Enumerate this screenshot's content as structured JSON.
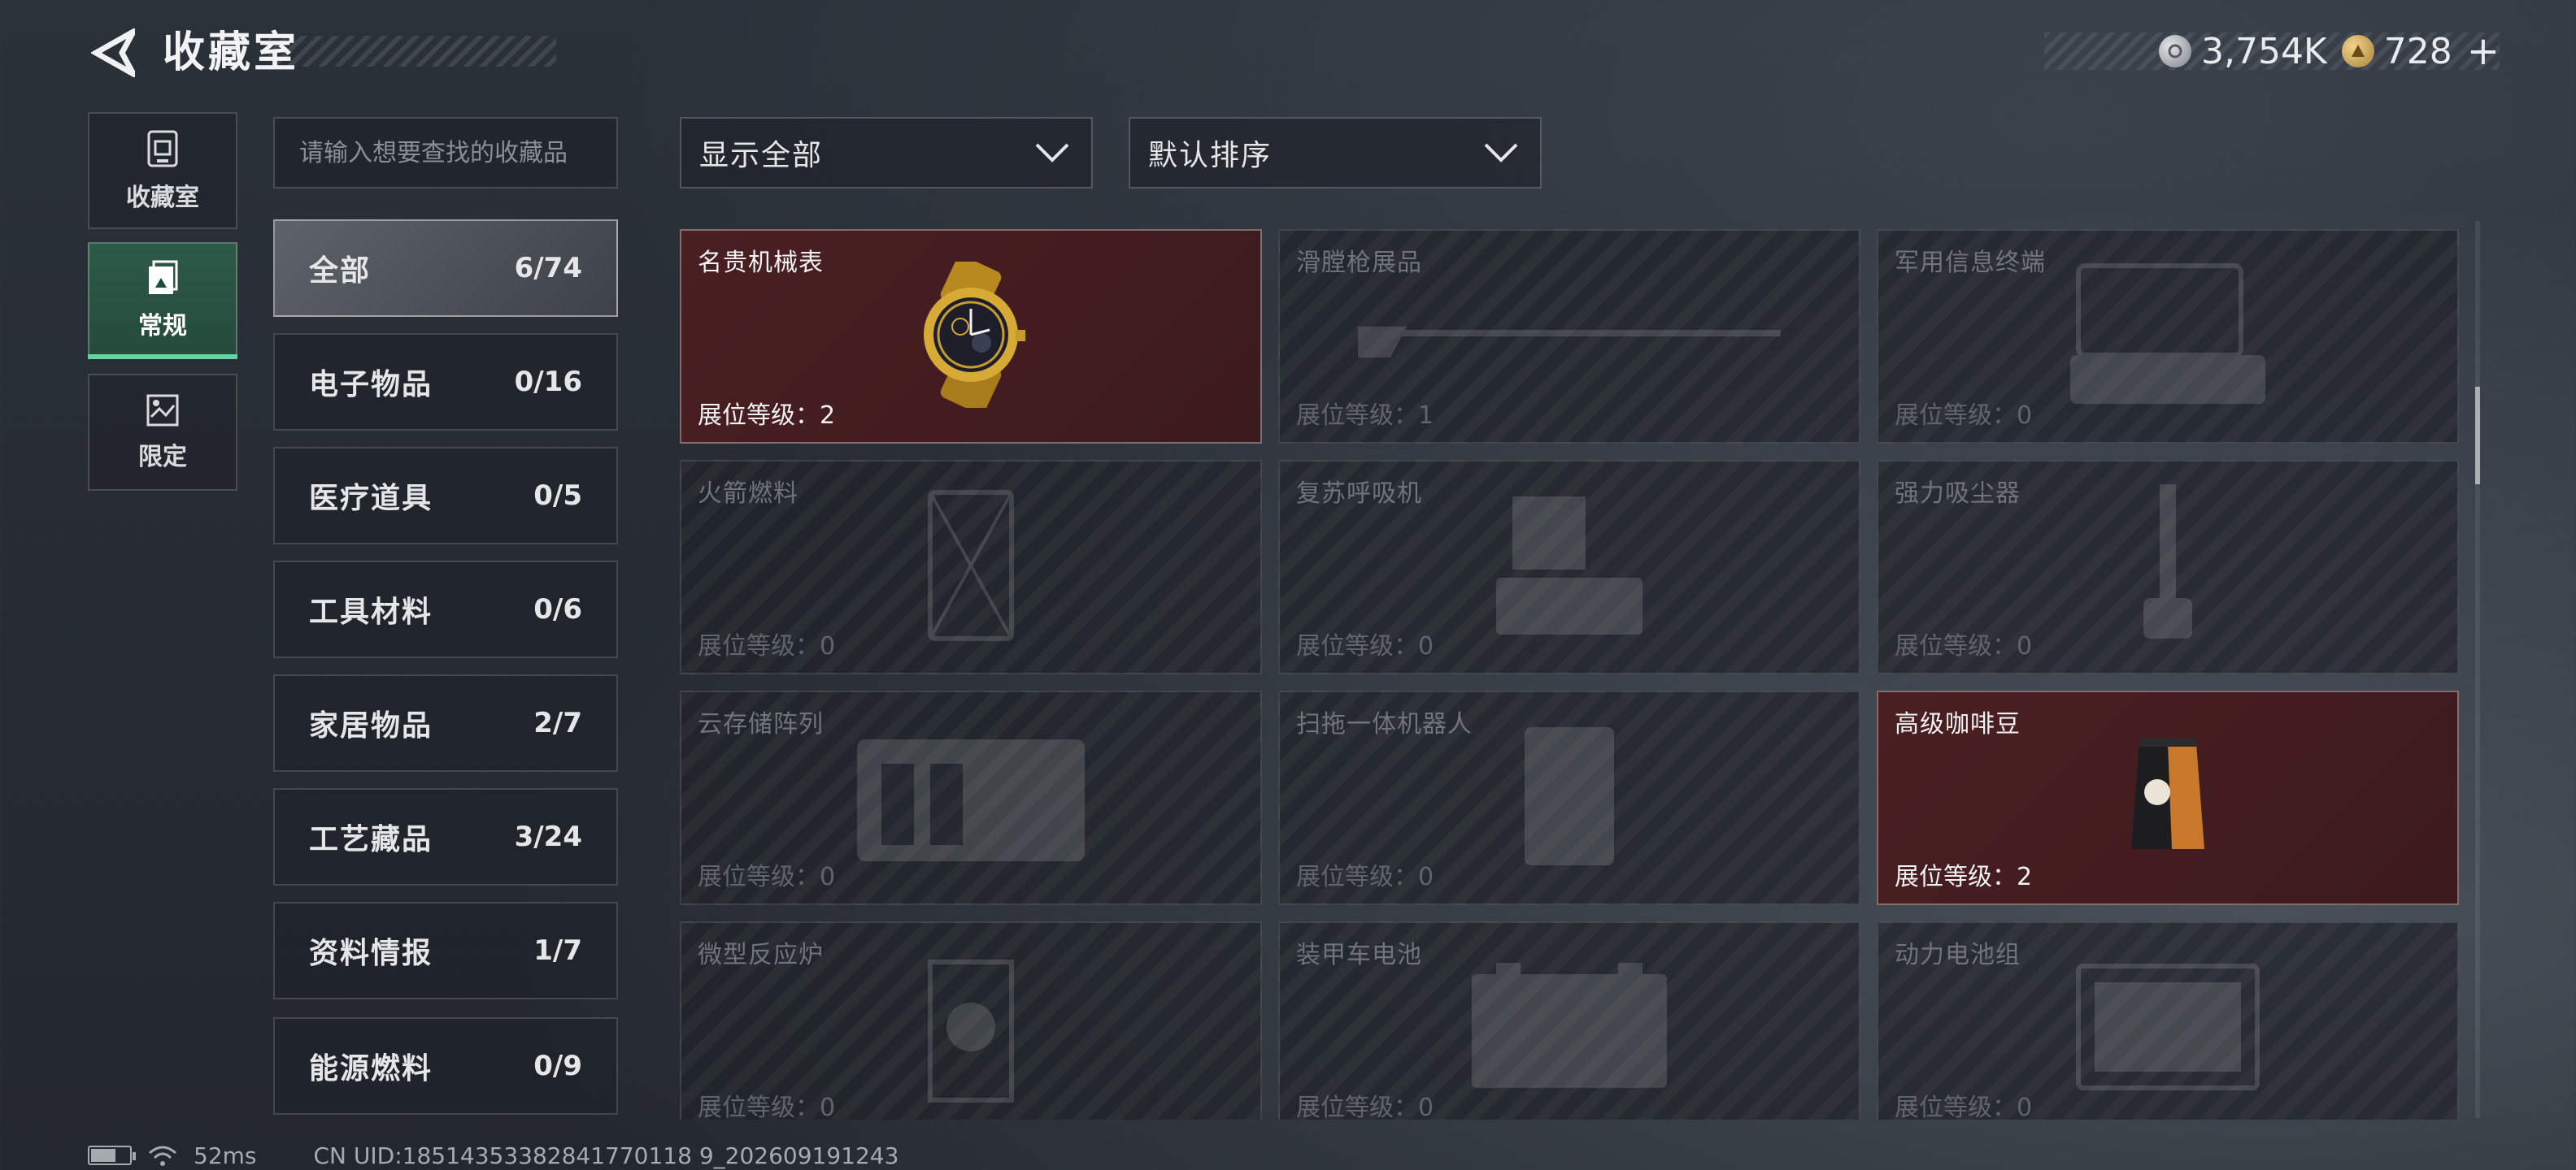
{
  "header": {
    "title": "收藏室",
    "currency": [
      {
        "icon": "silver-coin-icon",
        "value": "3,754K"
      },
      {
        "icon": "gold-coin-icon",
        "value": "728"
      }
    ],
    "add_label": "+"
  },
  "side_tabs": [
    {
      "label": "收藏室",
      "icon": "collection-room-icon",
      "active": false
    },
    {
      "label": "常规",
      "icon": "regular-icon",
      "active": true
    },
    {
      "label": "限定",
      "icon": "limited-icon",
      "active": false
    }
  ],
  "search": {
    "placeholder": "请输入想要查找的收藏品"
  },
  "categories": [
    {
      "name": "全部",
      "count": "6/74",
      "active": true
    },
    {
      "name": "电子物品",
      "count": "0/16"
    },
    {
      "name": "医疗道具",
      "count": "0/5"
    },
    {
      "name": "工具材料",
      "count": "0/6"
    },
    {
      "name": "家居物品",
      "count": "2/7"
    },
    {
      "name": "工艺藏品",
      "count": "3/24"
    },
    {
      "name": "资料情报",
      "count": "1/7"
    },
    {
      "name": "能源燃料",
      "count": "0/9"
    }
  ],
  "filters": {
    "show": "显示全部",
    "sort": "默认排序"
  },
  "level_prefix": "展位等级：",
  "items": [
    {
      "name": "名贵机械表",
      "level": "展位等级：2",
      "owned": true,
      "icon": "watch-icon"
    },
    {
      "name": "滑膛枪展品",
      "level": "展位等级：1",
      "owned": false,
      "icon": "musket-icon"
    },
    {
      "name": "军用信息终端",
      "level": "展位等级：0",
      "owned": false,
      "icon": "terminal-icon"
    },
    {
      "name": "火箭燃料",
      "level": "展位等级：0",
      "owned": false,
      "icon": "fuel-canister-icon"
    },
    {
      "name": "复苏呼吸机",
      "level": "展位等级：0",
      "owned": false,
      "icon": "ventilator-icon"
    },
    {
      "name": "强力吸尘器",
      "level": "展位等级：0",
      "owned": false,
      "icon": "vacuum-icon"
    },
    {
      "name": "云存储阵列",
      "level": "展位等级：0",
      "owned": false,
      "icon": "storage-array-icon"
    },
    {
      "name": "扫拖一体机器人",
      "level": "展位等级：0",
      "owned": false,
      "icon": "robot-icon"
    },
    {
      "name": "高级咖啡豆",
      "level": "展位等级：2",
      "owned": true,
      "icon": "coffee-bag-icon"
    },
    {
      "name": "微型反应炉",
      "level": "展位等级：0",
      "owned": false,
      "icon": "reactor-icon"
    },
    {
      "name": "装甲车电池",
      "level": "展位等级：0",
      "owned": false,
      "icon": "battery-icon"
    },
    {
      "name": "动力电池组",
      "level": "展位等级：0",
      "owned": false,
      "icon": "power-battery-icon"
    }
  ],
  "footer": {
    "ping": "52ms",
    "uid": "CN UID:18514353382841770118 9_202609191243"
  }
}
